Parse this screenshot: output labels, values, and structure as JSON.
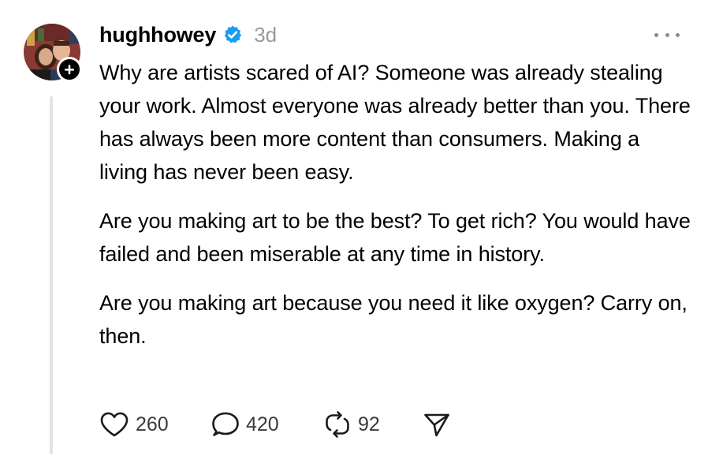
{
  "post": {
    "username": "hughhowey",
    "timestamp": "3d",
    "paragraphs": [
      "Why are artists scared of AI? Someone was already stealing your work. Almost everyone was already better than you. There has always been more content than consumers. Making a living has never been easy.",
      "Are you making art to be the best? To get rich? You would have failed and been miserable at any time in history.",
      "Are you making art because you need it like oxygen? Carry on, then."
    ],
    "actions": {
      "likes": "260",
      "replies": "420",
      "reposts": "92"
    },
    "icons": {
      "verified": "verified-badge-icon",
      "follow": "plus-icon",
      "more": "more-horizontal-icon",
      "like": "heart-icon",
      "reply": "speech-bubble-icon",
      "repost": "repost-icon",
      "share": "send-icon"
    },
    "colors": {
      "verified_blue": "#1d9bf0",
      "muted_text": "#999999",
      "thread_line": "#e3e3e3"
    }
  }
}
